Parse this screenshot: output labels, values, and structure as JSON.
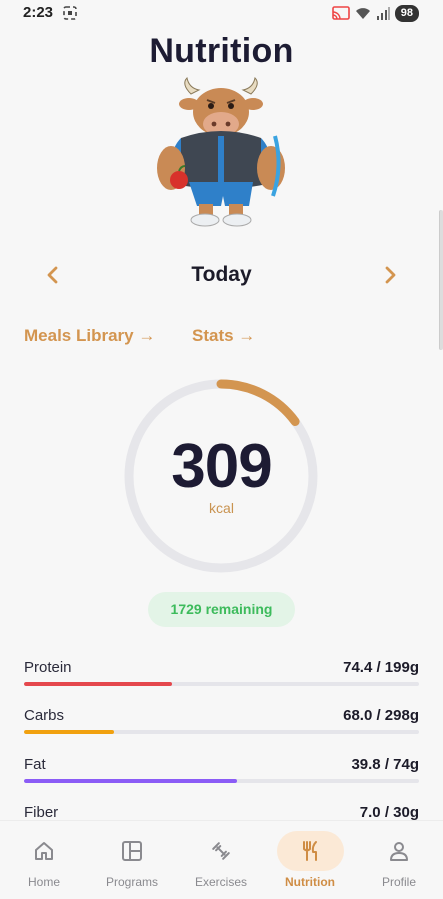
{
  "status_bar": {
    "time": "2:23",
    "battery": "98"
  },
  "title": "Nutrition",
  "date_nav": {
    "label": "Today"
  },
  "links": {
    "meals_library": "Meals Library →",
    "stats": "Stats →"
  },
  "calories": {
    "consumed": "309",
    "unit": "kcal",
    "remaining": "1729 remaining",
    "goal_fraction": 0.149,
    "ring_color": "#d39550",
    "track_color": "#e6e6ea"
  },
  "macros": [
    {
      "name": "Protein",
      "value": "74.4 / 199g",
      "fraction": 0.374,
      "color": "#e5484d"
    },
    {
      "name": "Carbs",
      "value": "68.0 / 298g",
      "fraction": 0.228,
      "color": "#f1a10f"
    },
    {
      "name": "Fat",
      "value": "39.8 / 74g",
      "fraction": 0.538,
      "color": "#8b5cf6"
    },
    {
      "name": "Fiber",
      "value": "7.0 / 30g",
      "fraction": 0.233,
      "color": "#3dbb5c"
    }
  ],
  "bottom_nav": [
    {
      "label": "Home",
      "icon": "home-icon"
    },
    {
      "label": "Programs",
      "icon": "programs-icon"
    },
    {
      "label": "Exercises",
      "icon": "dumbbell-icon"
    },
    {
      "label": "Nutrition",
      "icon": "fork-knife-icon",
      "active": true
    },
    {
      "label": "Profile",
      "icon": "profile-icon"
    }
  ],
  "colors": {
    "accent": "#d39550",
    "title": "#1d1c33",
    "remaining_bg": "#e3f4e7",
    "remaining_text": "#3dbb5c"
  }
}
